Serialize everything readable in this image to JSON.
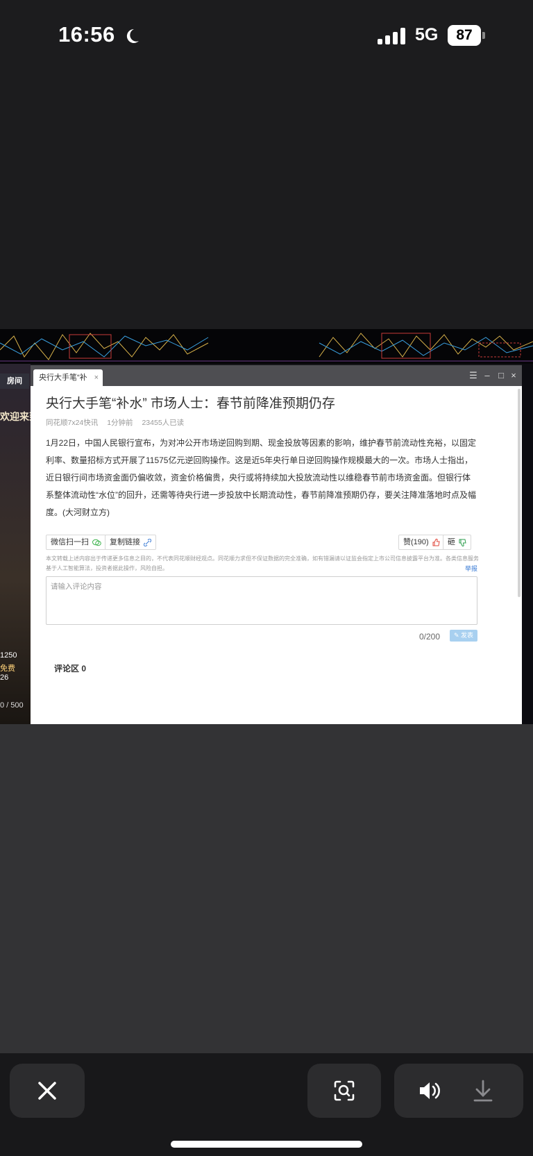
{
  "status_bar": {
    "time": "16:56",
    "network": "5G",
    "battery": "87",
    "icons": [
      "moon-icon",
      "signal-icon",
      "battery-icon"
    ]
  },
  "background_app": {
    "room_tab": "房间",
    "welcome_text": "欢迎来到",
    "stat_1": "1250",
    "stat_2": "免费",
    "stat_3": "26",
    "stat_4": "0 / 500"
  },
  "window": {
    "tab_title": "央行大手笔“补",
    "controls": [
      "menu-icon",
      "minimize-icon",
      "maximize-icon",
      "close-icon"
    ]
  },
  "article": {
    "title": "央行大手笔“补水” 市场人士：春节前降准预期仍存",
    "source": "同花顺7x24快讯",
    "time_ago": "1分钟前",
    "reads": "23455人已读",
    "body": "1月22日，中国人民银行宣布，为对冲公开市场逆回购到期、现金投放等因素的影响，维护春节前流动性充裕，以固定利率、数量招标方式开展了11575亿元逆回购操作。这是近5年央行单日逆回购操作规模最大的一次。市场人士指出，近日银行间市场资金面仍偏收敛，资金价格偏贵，央行或将持续加大投放流动性以维稳春节前市场资金面。但银行体系整体流动性“水位”的回升，还需等待央行进一步投放中长期流动性，春节前降准预期仍存，要关注降准落地时点及幅度。(大河财立方)"
  },
  "actions": {
    "wechat_scan": "微信扫一扫",
    "copy_link": "复制链接",
    "like": "赞(190)",
    "dislike": "砸"
  },
  "disclaimer": "本文转载上述内容出于传递更多信息之目的，不代表同花顺财经观点。同花顺力求但不保证数据的完全准确，如有错漏请以证监会指定上市公司信息披露平台为准。各类信息服务基于人工智能算法，投资者据此操作，风险自担。",
  "report_link": "举报",
  "comment": {
    "placeholder": "请输入评论内容",
    "counter": "0/200",
    "send_label": "发表",
    "section_title": "评论区 0"
  },
  "toolbar": {
    "icons": [
      "close-icon",
      "scan-search-icon",
      "volume-icon",
      "download-icon"
    ]
  },
  "colors": {
    "accent_blue": "#3a7bd5",
    "send_button": "#a8d0f0",
    "like_icon": "#e0473b",
    "dislike_icon": "#2e9e4f",
    "wechat_icon": "#3fb34f"
  }
}
